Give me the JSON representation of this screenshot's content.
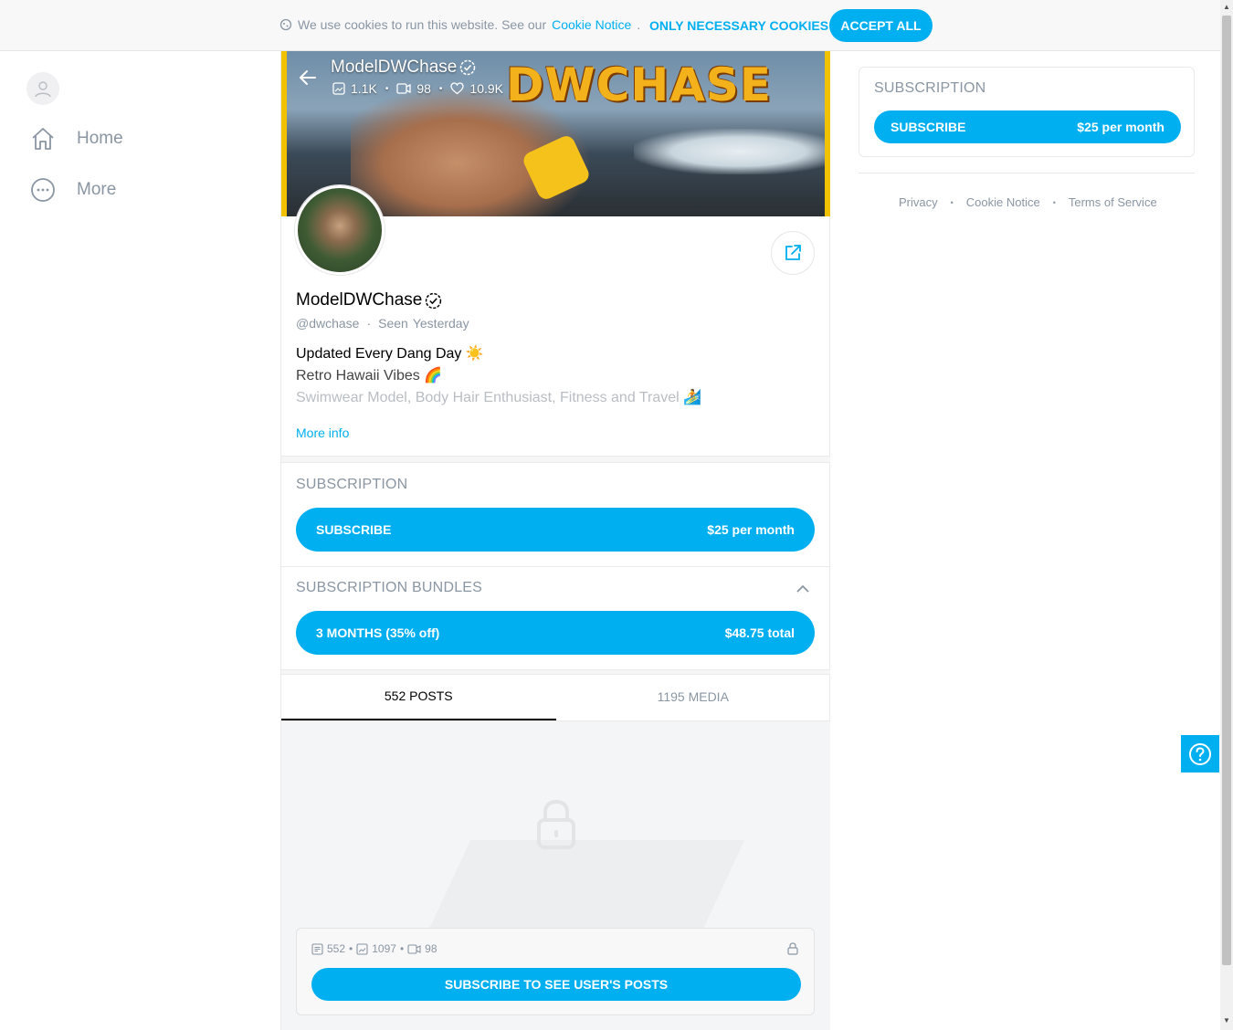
{
  "cookie_bar": {
    "text": "We use cookies to run this website. See our",
    "link": "Cookie Notice",
    "period": ".",
    "necessary_label": "ONLY NECESSARY COOKIES",
    "accept_label": "ACCEPT ALL"
  },
  "nav": {
    "items": [
      {
        "label": "Home",
        "icon": "home-icon"
      },
      {
        "label": "More",
        "icon": "more-icon"
      }
    ]
  },
  "cover": {
    "banner_text": "DWCHASE",
    "name": "ModelDWChase",
    "stats": {
      "images": "1.1K",
      "videos": "98",
      "likes": "10.9K"
    }
  },
  "profile": {
    "name": "ModelDWChase",
    "handle": "@dwchase",
    "seen_label": "Seen",
    "seen_value": "Yesterday",
    "bio": [
      "Updated Every Dang Day ☀️",
      "Retro Hawaii Vibes 🌈",
      "Swimwear Model, Body Hair Enthusiast, Fitness and Travel 🏄"
    ],
    "more_info": "More info"
  },
  "subscription": {
    "title": "SUBSCRIPTION",
    "button_label": "SUBSCRIBE",
    "price": "$25 per month"
  },
  "bundles": {
    "title": "SUBSCRIPTION BUNDLES",
    "button_label": "3 MONTHS (35% off)",
    "price": "$48.75 total"
  },
  "tabs": [
    {
      "label": "552 POSTS",
      "active": true
    },
    {
      "label": "1195 MEDIA",
      "active": false
    }
  ],
  "locked": {
    "posts": "552",
    "images": "1097",
    "videos": "98",
    "button_label": "SUBSCRIBE TO SEE USER'S POSTS"
  },
  "sidebar_right": {
    "title": "SUBSCRIPTION",
    "button_label": "SUBSCRIBE",
    "price": "$25 per month",
    "footer_links": [
      "Privacy",
      "Cookie Notice",
      "Terms of Service"
    ]
  },
  "colors": {
    "accent": "#00aff0",
    "muted": "#8a96a3"
  }
}
